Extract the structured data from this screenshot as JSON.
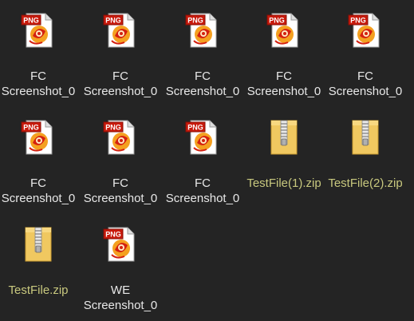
{
  "colors": {
    "background": "#242424",
    "label_text": "#e8e8e8",
    "zip_label_text": "#c8c87e"
  },
  "files": [
    {
      "name_line1": "FC",
      "name_line2": "Screenshot_0",
      "icon": "png-file-icon",
      "type": "png"
    },
    {
      "name_line1": "FC",
      "name_line2": "Screenshot_0",
      "icon": "png-file-icon",
      "type": "png"
    },
    {
      "name_line1": "FC",
      "name_line2": "Screenshot_0",
      "icon": "png-file-icon",
      "type": "png"
    },
    {
      "name_line1": "FC",
      "name_line2": "Screenshot_0",
      "icon": "png-file-icon",
      "type": "png"
    },
    {
      "name_line1": "FC",
      "name_line2": "Screenshot_0",
      "icon": "png-file-icon",
      "type": "png"
    },
    {
      "name_line1": "FC",
      "name_line2": "Screenshot_0",
      "icon": "png-file-icon",
      "type": "png"
    },
    {
      "name_line1": "FC",
      "name_line2": "Screenshot_0",
      "icon": "png-file-icon",
      "type": "png"
    },
    {
      "name_line1": "FC",
      "name_line2": "Screenshot_0",
      "icon": "png-file-icon",
      "type": "png"
    },
    {
      "name_line1": "TestFile(1).zip",
      "name_line2": "",
      "icon": "zip-folder-icon",
      "type": "zip"
    },
    {
      "name_line1": "TestFile(2).zip",
      "name_line2": "",
      "icon": "zip-folder-icon",
      "type": "zip"
    },
    {
      "name_line1": "TestFile.zip",
      "name_line2": "",
      "icon": "zip-folder-icon",
      "type": "zip"
    },
    {
      "name_line1": "WE",
      "name_line2": "Screenshot_0",
      "icon": "png-file-icon",
      "type": "png"
    }
  ],
  "png_badge_text": "PNG"
}
